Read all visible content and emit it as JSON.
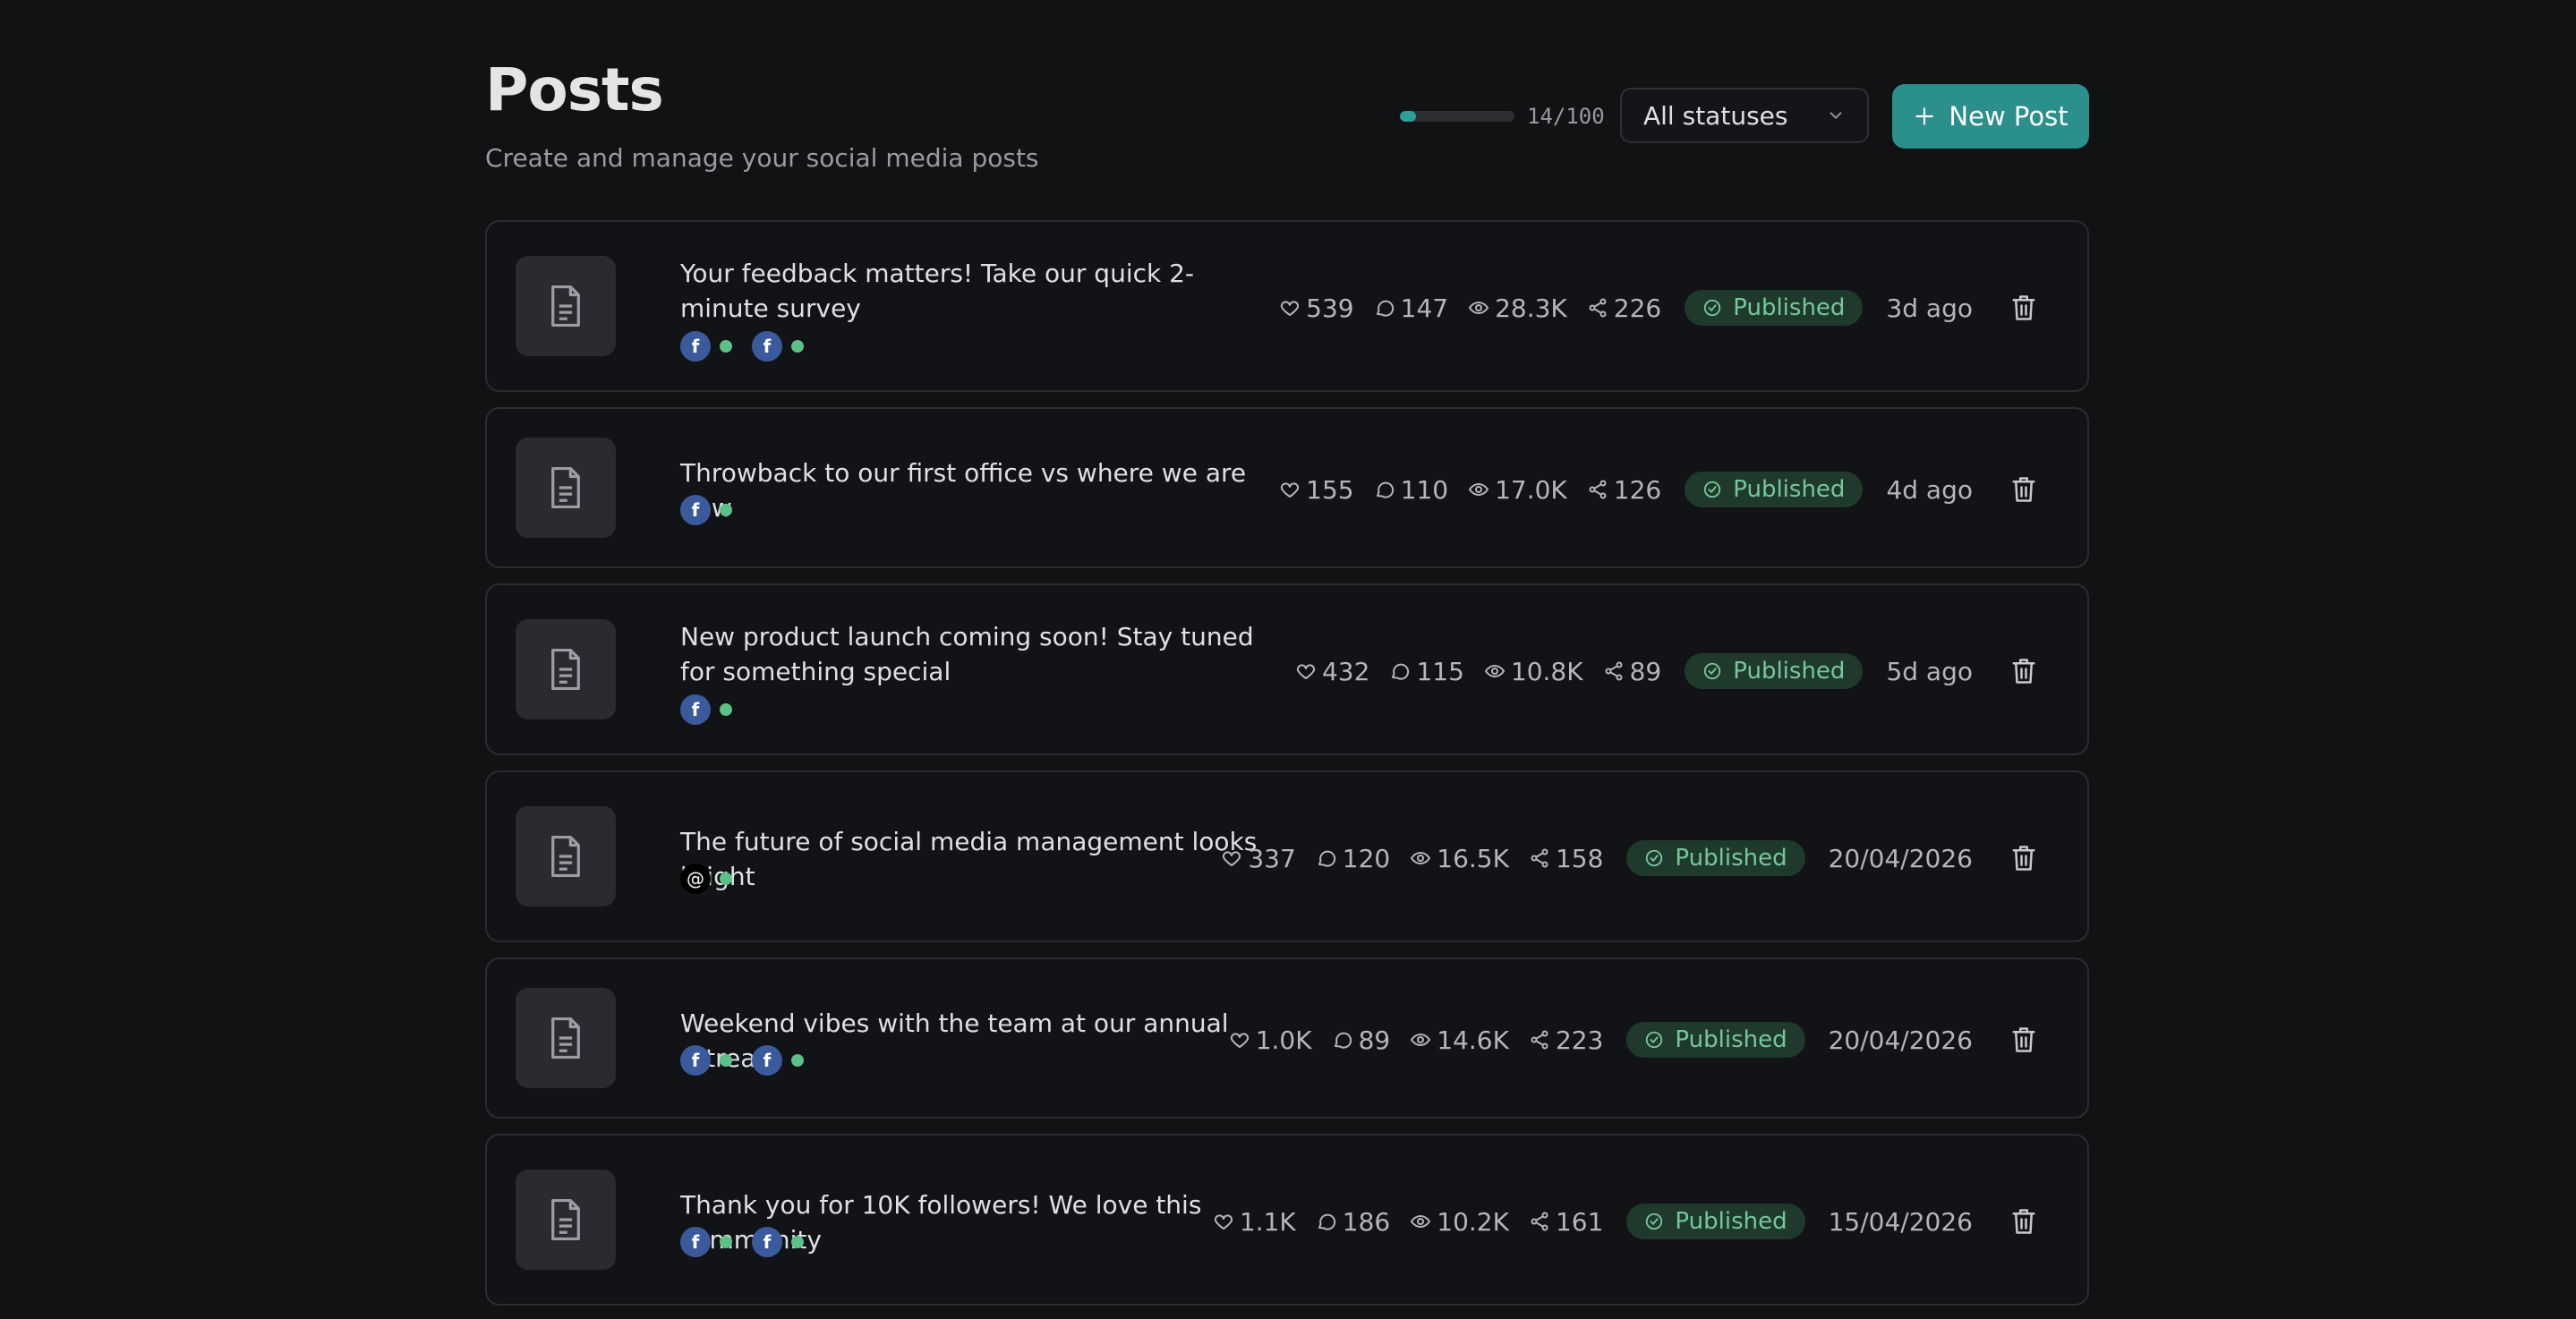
{
  "header": {
    "title": "Posts",
    "subtitle": "Create and manage your social media posts",
    "usage_text": "14/100",
    "usage_fraction": 0.14,
    "status_filter": "All statuses",
    "new_post_label": "New Post"
  },
  "colors": {
    "accent": "#2b8f8c",
    "published_bg": "#1f3a2d",
    "published_text": "#76c79a",
    "facebook": "#3a5a9c",
    "connected_dot": "#5cc087"
  },
  "posts": [
    {
      "title": "Your feedback matters! Take our quick 2-minute survey",
      "platforms": [
        "facebook-icon",
        "facebook-icon"
      ],
      "likes": "539",
      "comments": "147",
      "views": "28.3K",
      "shares": "226",
      "status": "Published",
      "time": "3d ago"
    },
    {
      "title": "Throwback to our first office vs where we are now",
      "platforms": [
        "facebook-icon"
      ],
      "likes": "155",
      "comments": "110",
      "views": "17.0K",
      "shares": "126",
      "status": "Published",
      "time": "4d ago"
    },
    {
      "title": "New product launch coming soon! Stay tuned for something special",
      "platforms": [
        "facebook-icon"
      ],
      "likes": "432",
      "comments": "115",
      "views": "10.8K",
      "shares": "89",
      "status": "Published",
      "time": "5d ago"
    },
    {
      "title": "The future of social media management looks bright",
      "platforms": [
        "threads-icon"
      ],
      "likes": "337",
      "comments": "120",
      "views": "16.5K",
      "shares": "158",
      "status": "Published",
      "time": "20/04/2026"
    },
    {
      "title": "Weekend vibes with the team at our annual retreat",
      "platforms": [
        "facebook-icon",
        "facebook-icon"
      ],
      "likes": "1.0K",
      "comments": "89",
      "views": "14.6K",
      "shares": "223",
      "status": "Published",
      "time": "20/04/2026"
    },
    {
      "title": "Thank you for 10K followers! We love this community",
      "platforms": [
        "facebook-icon",
        "facebook-icon"
      ],
      "likes": "1.1K",
      "comments": "186",
      "views": "10.2K",
      "shares": "161",
      "status": "Published",
      "time": "15/04/2026"
    }
  ]
}
